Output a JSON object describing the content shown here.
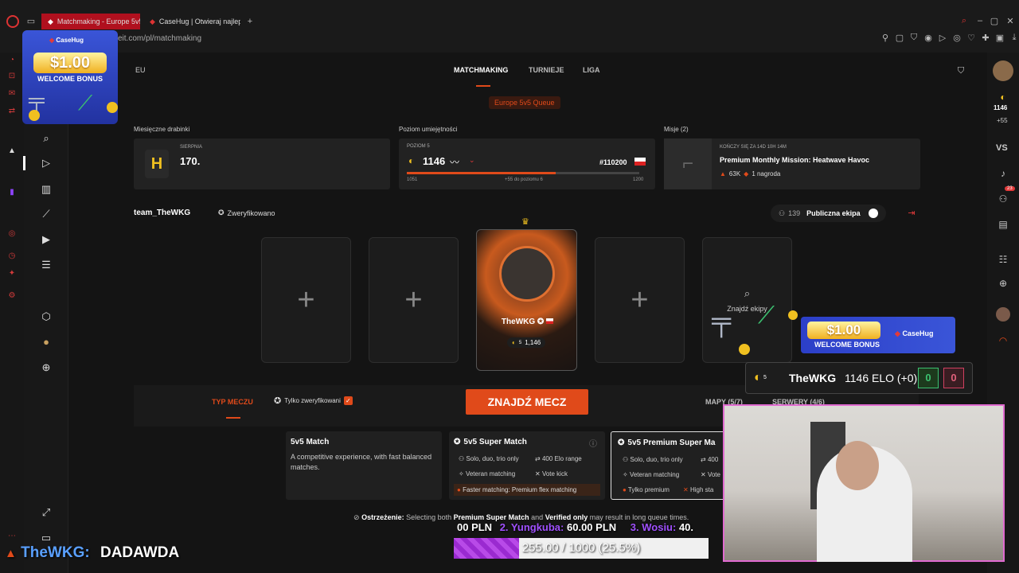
{
  "browser": {
    "tabs": [
      {
        "label": "Matchmaking - Europe 5v5"
      },
      {
        "label": "CaseHug | Otwieraj najlep"
      }
    ],
    "url": "eit.com/pl/matchmaking"
  },
  "casehug_ad": {
    "brand": "CaseHug",
    "amount": "$1.00",
    "label": "WELCOME BONUS"
  },
  "header": {
    "region": "EU",
    "nav": [
      {
        "label": "MATCHMAKING"
      },
      {
        "label": "TURNIEJE"
      },
      {
        "label": "LIGA"
      }
    ],
    "queue_badge": "Europe 5v5 Queue"
  },
  "stats": {
    "ladder": {
      "section": "Miesięczne drabinki",
      "month": "SIERPNIA",
      "value": "170."
    },
    "skill": {
      "section": "Poziom umiejętności",
      "level": "POZIOM 5",
      "elo": "1146",
      "rank": "#110200",
      "min": "1051",
      "progress_text": "+55 do poziomu 6",
      "max": "1200",
      "progress": 0.64
    },
    "missions": {
      "section": "Misje (2)",
      "ends": "KOŃCZY SIĘ ZA 14D 10H 14M",
      "title": "Premium Monthly Mission: Heatwave Havoc",
      "fire_count": "63K",
      "reward": "1 nagroda"
    }
  },
  "team": {
    "name": "team_TheWKG",
    "verified": "Zweryfikowano",
    "count": "139",
    "public_label": "Publiczna ekipa"
  },
  "lobby": {
    "player": {
      "name": "TheWKG",
      "level": "5",
      "elo": "1,146"
    },
    "find_team": "Znajdź ekipy"
  },
  "settings": {
    "match_type": "TYP MECZU",
    "verified_only": "Tylko zweryfikowani",
    "find_match": "ZNAJDŹ MECZ",
    "maps": "MAPY (5/7)",
    "servers": "SERWERY (4/6)"
  },
  "modes": [
    {
      "title": "5v5 Match",
      "desc": "A competitive experience, with fast balanced matches."
    },
    {
      "title": "5v5 Super Match",
      "f1": "Solo, duo, trio only",
      "f2": "400 Elo range",
      "f3": "Veteran matching",
      "f4": "Vote kick",
      "note": "Faster matching: Premium flex matching"
    },
    {
      "title": "5v5 Premium Super Ma",
      "f1": "Solo, duo, trio only",
      "f2": "400",
      "f3": "Veteran matching",
      "f4": "Vote",
      "note1": "Tylko premium",
      "note2": "High sta"
    }
  ],
  "warning": {
    "prefix": "Ostrzeżenie:",
    "text1": " Selecting both ",
    "bold1": "Premium Super Match",
    "text2": " and ",
    "bold2": "Verified only",
    "text3": " may result in long queue times."
  },
  "overlay": {
    "elo_widget": {
      "name": "TheWKG",
      "elo_text": "1146 ELO (+0)",
      "wins": "0",
      "losses": "0",
      "level": "5"
    },
    "ticker": {
      "t1": "00 PLN",
      "t2": "2. Yungkuba:",
      "t3": "60.00 PLN",
      "t4": "3. Wosiu:",
      "t5": "40."
    },
    "goal": {
      "text": "255.00 / 1000 (25.5%)",
      "progress": 0.255
    },
    "chat": {
      "user": "TheWKG:",
      "message": "DADAWDA"
    }
  },
  "right_rail": {
    "elo": "1146",
    "delta": "+55",
    "vs": "VS",
    "badge": "23"
  },
  "colors": {
    "accent": "#e04a1a",
    "red": "#e23a3a",
    "bg": "#141414"
  }
}
